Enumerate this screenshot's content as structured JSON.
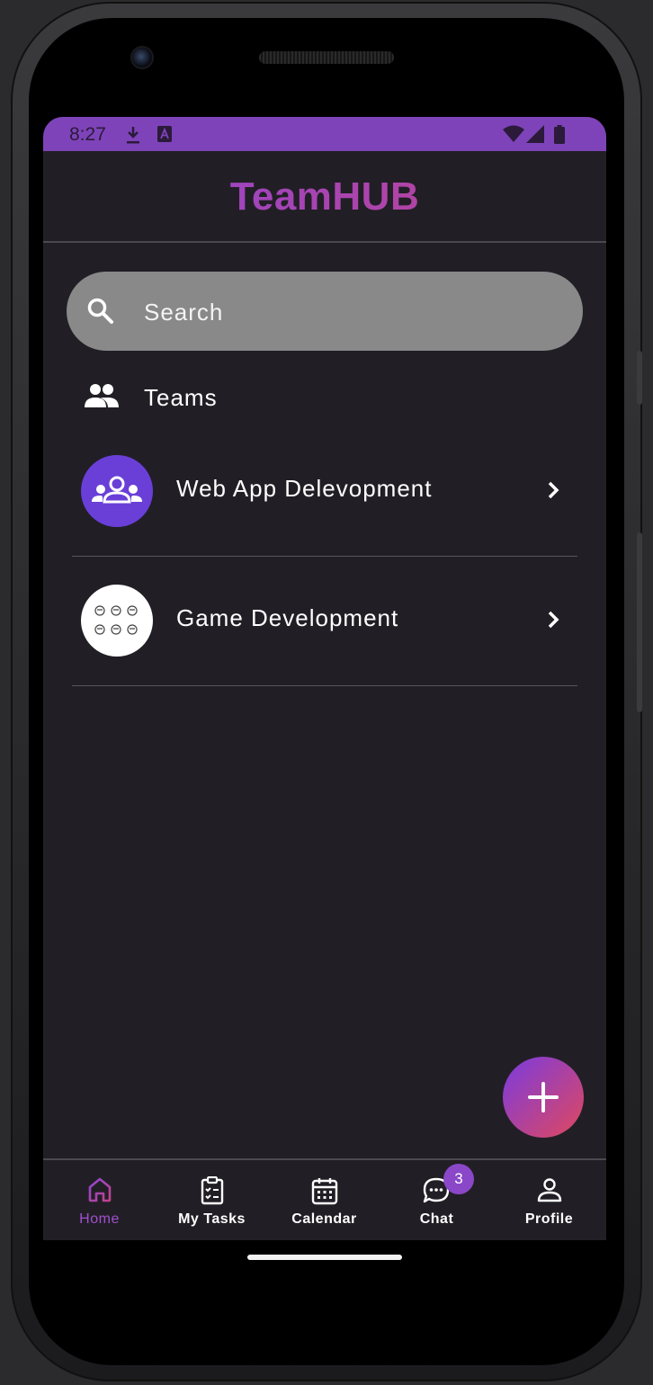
{
  "status_bar": {
    "time": "8:27"
  },
  "app": {
    "title": "TeamHUB"
  },
  "search": {
    "placeholder": "Search"
  },
  "teams_section": {
    "label": "Teams"
  },
  "teams": [
    {
      "name": "Web App Delevopment",
      "avatar": "group-avatar",
      "avatar_color": "#6a3fd8"
    },
    {
      "name": "Game Development",
      "avatar": "faces-avatar",
      "avatar_color": "#ffffff"
    }
  ],
  "bottom_nav": {
    "items": [
      {
        "label": "Home",
        "icon": "home-icon",
        "active": true
      },
      {
        "label": "My Tasks",
        "icon": "clipboard-icon",
        "active": false
      },
      {
        "label": "Calendar",
        "icon": "calendar-icon",
        "active": false
      },
      {
        "label": "Chat",
        "icon": "chat-icon",
        "active": false,
        "badge": "3"
      },
      {
        "label": "Profile",
        "icon": "person-icon",
        "active": false
      }
    ]
  },
  "colors": {
    "accent": "#7e43b9",
    "background": "#211f25",
    "search_bg": "#898989",
    "active_nav": "#a24fd0",
    "badge": "#8a47c8"
  }
}
